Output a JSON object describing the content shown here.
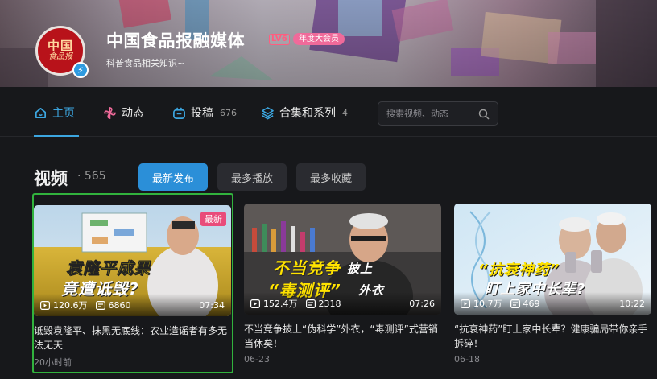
{
  "profile": {
    "name": "中国食品报融媒体",
    "level": "LV6",
    "badge": "年度大会员",
    "sign": "科普食品相关知识~",
    "avatar_text_1": "中国",
    "avatar_text_2": "食品报"
  },
  "nav": {
    "tabs": [
      {
        "label": "主页",
        "count": "",
        "icon": "home-icon",
        "active": true
      },
      {
        "label": "动态",
        "count": "",
        "icon": "pinwheel-icon",
        "active": false
      },
      {
        "label": "投稿",
        "count": "676",
        "icon": "tv-icon",
        "active": false
      },
      {
        "label": "合集和系列",
        "count": "4",
        "icon": "layers-icon",
        "active": false
      }
    ],
    "search_placeholder": "搜索视频、动态"
  },
  "videos_section": {
    "title": "视频",
    "count": "· 565",
    "sort_buttons": [
      {
        "label": "最新发布",
        "active": true
      },
      {
        "label": "最多播放",
        "active": false
      },
      {
        "label": "最多收藏",
        "active": false
      }
    ]
  },
  "videos": [
    {
      "title": "诋毁袁隆平、抹黑无底线：农业造谣者有多无法无天",
      "views": "120.6万",
      "danmaku": "6860",
      "duration": "07:34",
      "date": "20小时前",
      "tag": "最新",
      "caption_1": "袁隆平成果",
      "caption_2": "竟遭诋毁?"
    },
    {
      "title": "不当竞争披上“伪科学”外衣，“毒测评”式营销当休矣！",
      "views": "152.4万",
      "danmaku": "2318",
      "duration": "07:26",
      "date": "06-23",
      "caption_1": "不当竞争",
      "caption_1b": "披上",
      "caption_2": "“毒测评”",
      "caption_2b": "外衣"
    },
    {
      "title": "“抗衰神药”盯上家中长辈？健康骗局带你亲手拆碎！",
      "views": "10.7万",
      "danmaku": "469",
      "duration": "10:22",
      "date": "06-18",
      "caption_1": "“抗衰神药”",
      "caption_2": "盯上家中长辈?"
    }
  ],
  "colors": {
    "accent": "#3ca6e0",
    "primary_button": "#2b8fd8",
    "new_tag": "#e94c7a",
    "selection_border": "#31b23d",
    "background": "#17181b"
  }
}
